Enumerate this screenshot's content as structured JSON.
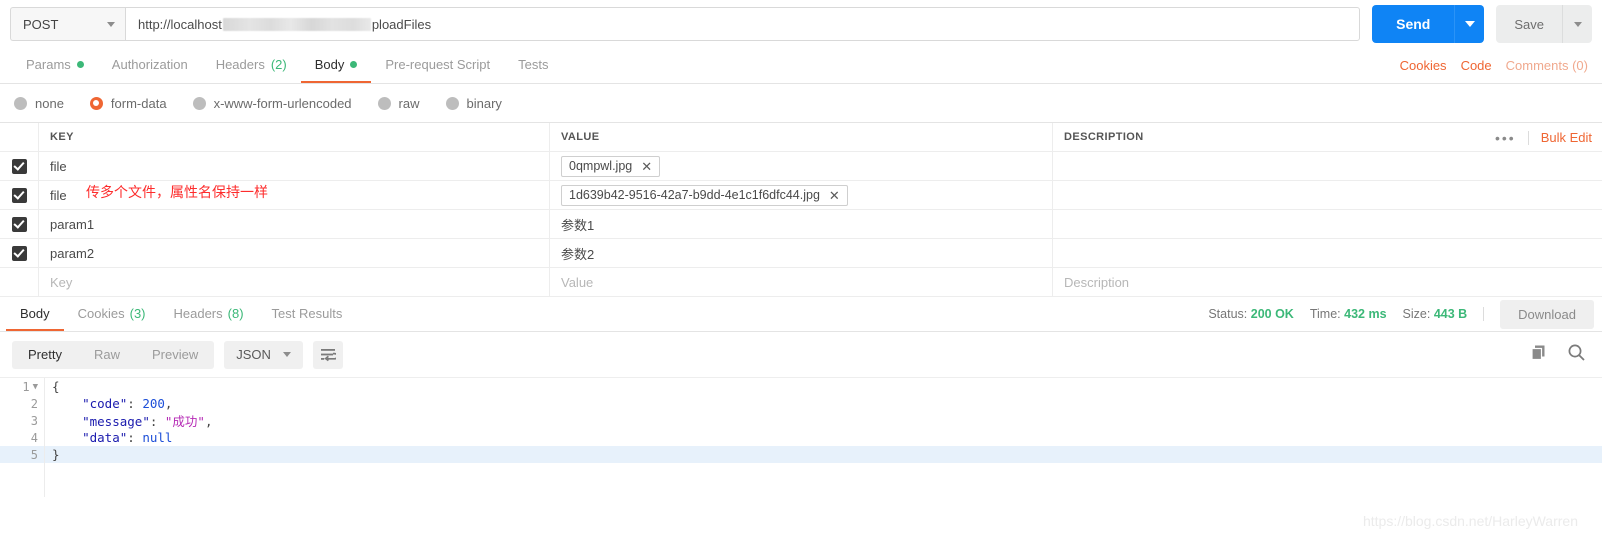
{
  "request": {
    "method": "POST",
    "url_prefix": "http://localhost",
    "url_suffix": "ploadFiles",
    "send_label": "Send",
    "save_label": "Save",
    "tabs": [
      {
        "label": "Params",
        "badge": "",
        "dot": true,
        "active": false
      },
      {
        "label": "Authorization",
        "badge": "",
        "dot": false,
        "active": false
      },
      {
        "label": "Headers",
        "badge": "(2)",
        "dot": false,
        "active": false
      },
      {
        "label": "Body",
        "badge": "",
        "dot": true,
        "active": true
      },
      {
        "label": "Pre-request Script",
        "badge": "",
        "dot": false,
        "active": false
      },
      {
        "label": "Tests",
        "badge": "",
        "dot": false,
        "active": false
      }
    ],
    "right_links": {
      "cookies": "Cookies",
      "code": "Code",
      "comments": "Comments (0)"
    },
    "body_types": [
      {
        "label": "none",
        "selected": false
      },
      {
        "label": "form-data",
        "selected": true
      },
      {
        "label": "x-www-form-urlencoded",
        "selected": false
      },
      {
        "label": "raw",
        "selected": false
      },
      {
        "label": "binary",
        "selected": false
      }
    ],
    "table": {
      "headers": {
        "key": "KEY",
        "value": "VALUE",
        "description": "DESCRIPTION"
      },
      "bulk_edit": "Bulk Edit",
      "more_dots": "•••",
      "rows": [
        {
          "checked": true,
          "key": "file",
          "value": "0qmpwl.jpg",
          "is_file": true,
          "description": ""
        },
        {
          "checked": true,
          "key": "file",
          "value": "1d639b42-9516-42a7-b9dd-4e1c1f6dfc44.jpg",
          "is_file": true,
          "description": ""
        },
        {
          "checked": true,
          "key": "param1",
          "value": "参数1",
          "is_file": false,
          "description": ""
        },
        {
          "checked": true,
          "key": "param2",
          "value": "参数2",
          "is_file": false,
          "description": ""
        }
      ],
      "empty_row": {
        "key": "Key",
        "value": "Value",
        "description": "Description"
      }
    },
    "annotation": "传多个文件，属性名保持一样"
  },
  "response": {
    "tabs": [
      {
        "label": "Body",
        "badge": "",
        "active": true
      },
      {
        "label": "Cookies",
        "badge": "(3)",
        "active": false
      },
      {
        "label": "Headers",
        "badge": "(8)",
        "active": false
      },
      {
        "label": "Test Results",
        "badge": "",
        "active": false
      }
    ],
    "meta": {
      "status_label": "Status:",
      "status_value": "200 OK",
      "time_label": "Time:",
      "time_value": "432 ms",
      "size_label": "Size:",
      "size_value": "443 B",
      "download_label": "Download"
    },
    "toolbar": {
      "view_modes": [
        {
          "label": "Pretty",
          "active": true
        },
        {
          "label": "Raw",
          "active": false
        },
        {
          "label": "Preview",
          "active": false
        }
      ],
      "format": "JSON"
    },
    "code": {
      "lines": [
        {
          "n": "1",
          "fold": true,
          "highlight": false
        },
        {
          "n": "2",
          "fold": false,
          "highlight": false
        },
        {
          "n": "3",
          "fold": false,
          "highlight": false
        },
        {
          "n": "4",
          "fold": false,
          "highlight": false
        },
        {
          "n": "5",
          "fold": false,
          "highlight": true
        }
      ],
      "code_key": "\"code\"",
      "code_value": "200",
      "message_key": "\"message\"",
      "message_value": "\"成功\"",
      "data_key": "\"data\"",
      "data_value": "null",
      "open_brace": "{",
      "close_brace": "}"
    }
  },
  "watermark": "https://blog.csdn.net/HarleyWarren",
  "colors": {
    "accent_orange": "#ef6633",
    "send_blue": "#0f84f5",
    "status_green": "#3cb878",
    "annotation_red": "#fd2c2c",
    "checkbox_dark": "#3a3a3a"
  }
}
